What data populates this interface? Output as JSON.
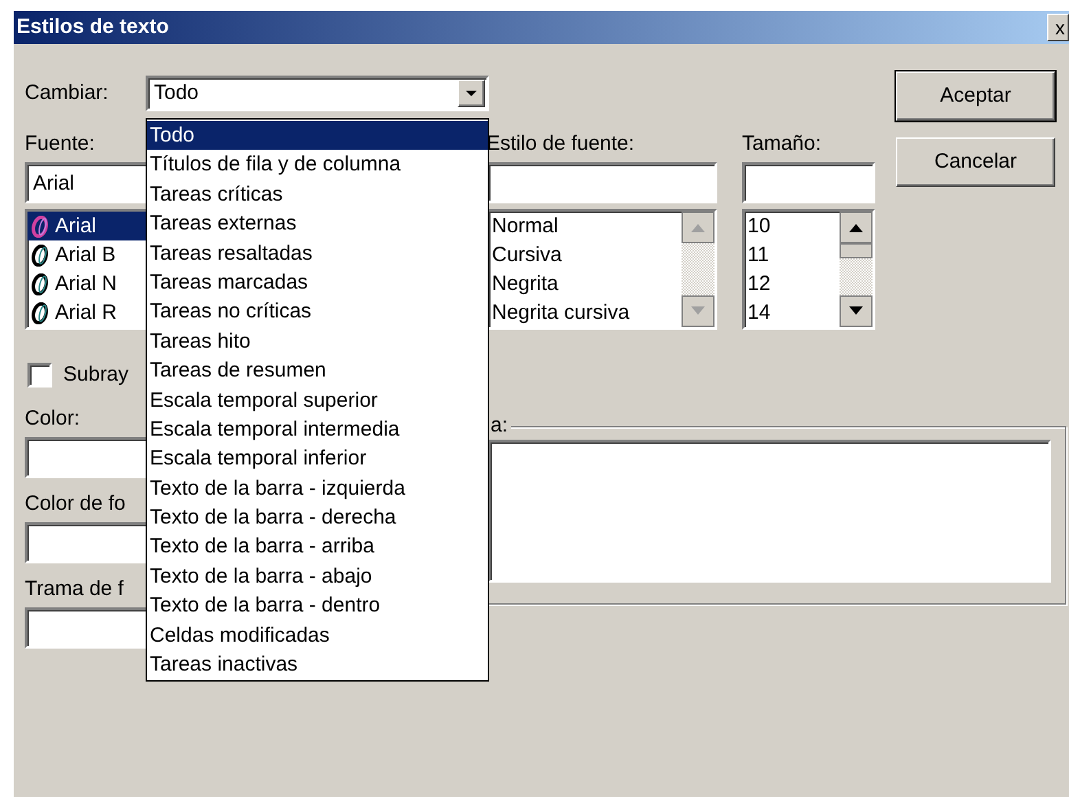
{
  "window": {
    "title": "Estilos de texto",
    "close": "x"
  },
  "change": {
    "label": "Cambiar:",
    "value": "Todo",
    "expanded": true,
    "options": [
      {
        "label": "Todo",
        "selected": true
      },
      {
        "label": "Títulos de fila y de columna",
        "selected": false
      },
      {
        "label": "Tareas críticas",
        "selected": false
      },
      {
        "label": "Tareas externas",
        "selected": false
      },
      {
        "label": "Tareas resaltadas",
        "selected": false
      },
      {
        "label": "Tareas marcadas",
        "selected": false
      },
      {
        "label": "Tareas no críticas",
        "selected": false
      },
      {
        "label": "Tareas hito",
        "selected": false
      },
      {
        "label": "Tareas de resumen",
        "selected": false
      },
      {
        "label": "Escala temporal superior",
        "selected": false
      },
      {
        "label": "Escala temporal intermedia",
        "selected": false
      },
      {
        "label": "Escala temporal inferior",
        "selected": false
      },
      {
        "label": "Texto de la barra - izquierda",
        "selected": false
      },
      {
        "label": "Texto de la barra - derecha",
        "selected": false
      },
      {
        "label": "Texto de la barra - arriba",
        "selected": false
      },
      {
        "label": "Texto de la barra - abajo",
        "selected": false
      },
      {
        "label": "Texto de la barra - dentro",
        "selected": false
      },
      {
        "label": "Celdas modificadas",
        "selected": false
      },
      {
        "label": "Tareas inactivas",
        "selected": false
      }
    ]
  },
  "font": {
    "label": "Fuente:",
    "value": "Arial",
    "items": [
      {
        "label": "Arial",
        "selected": true
      },
      {
        "label": "Arial B",
        "selected": false
      },
      {
        "label": "Arial N",
        "selected": false
      },
      {
        "label": "Arial R",
        "selected": false
      }
    ]
  },
  "font_style": {
    "label": "Estilo de fuente:",
    "items": [
      "Normal",
      "Cursiva",
      "Negrita",
      "Negrita cursiva"
    ],
    "scrollbar": {
      "disabled": true
    }
  },
  "size": {
    "label": "Tamaño:",
    "items": [
      "10",
      "11",
      "12",
      "14"
    ],
    "scrollbar": {
      "disabled": false
    }
  },
  "buttons": [
    "Aceptar",
    "Cancelar"
  ],
  "underline": {
    "label": "Subray",
    "checked": false
  },
  "color": {
    "label": "Color:"
  },
  "background_color": {
    "label": "Color de fo"
  },
  "pattern": {
    "label": "Trama de f"
  },
  "sample": {
    "label": "a:"
  }
}
